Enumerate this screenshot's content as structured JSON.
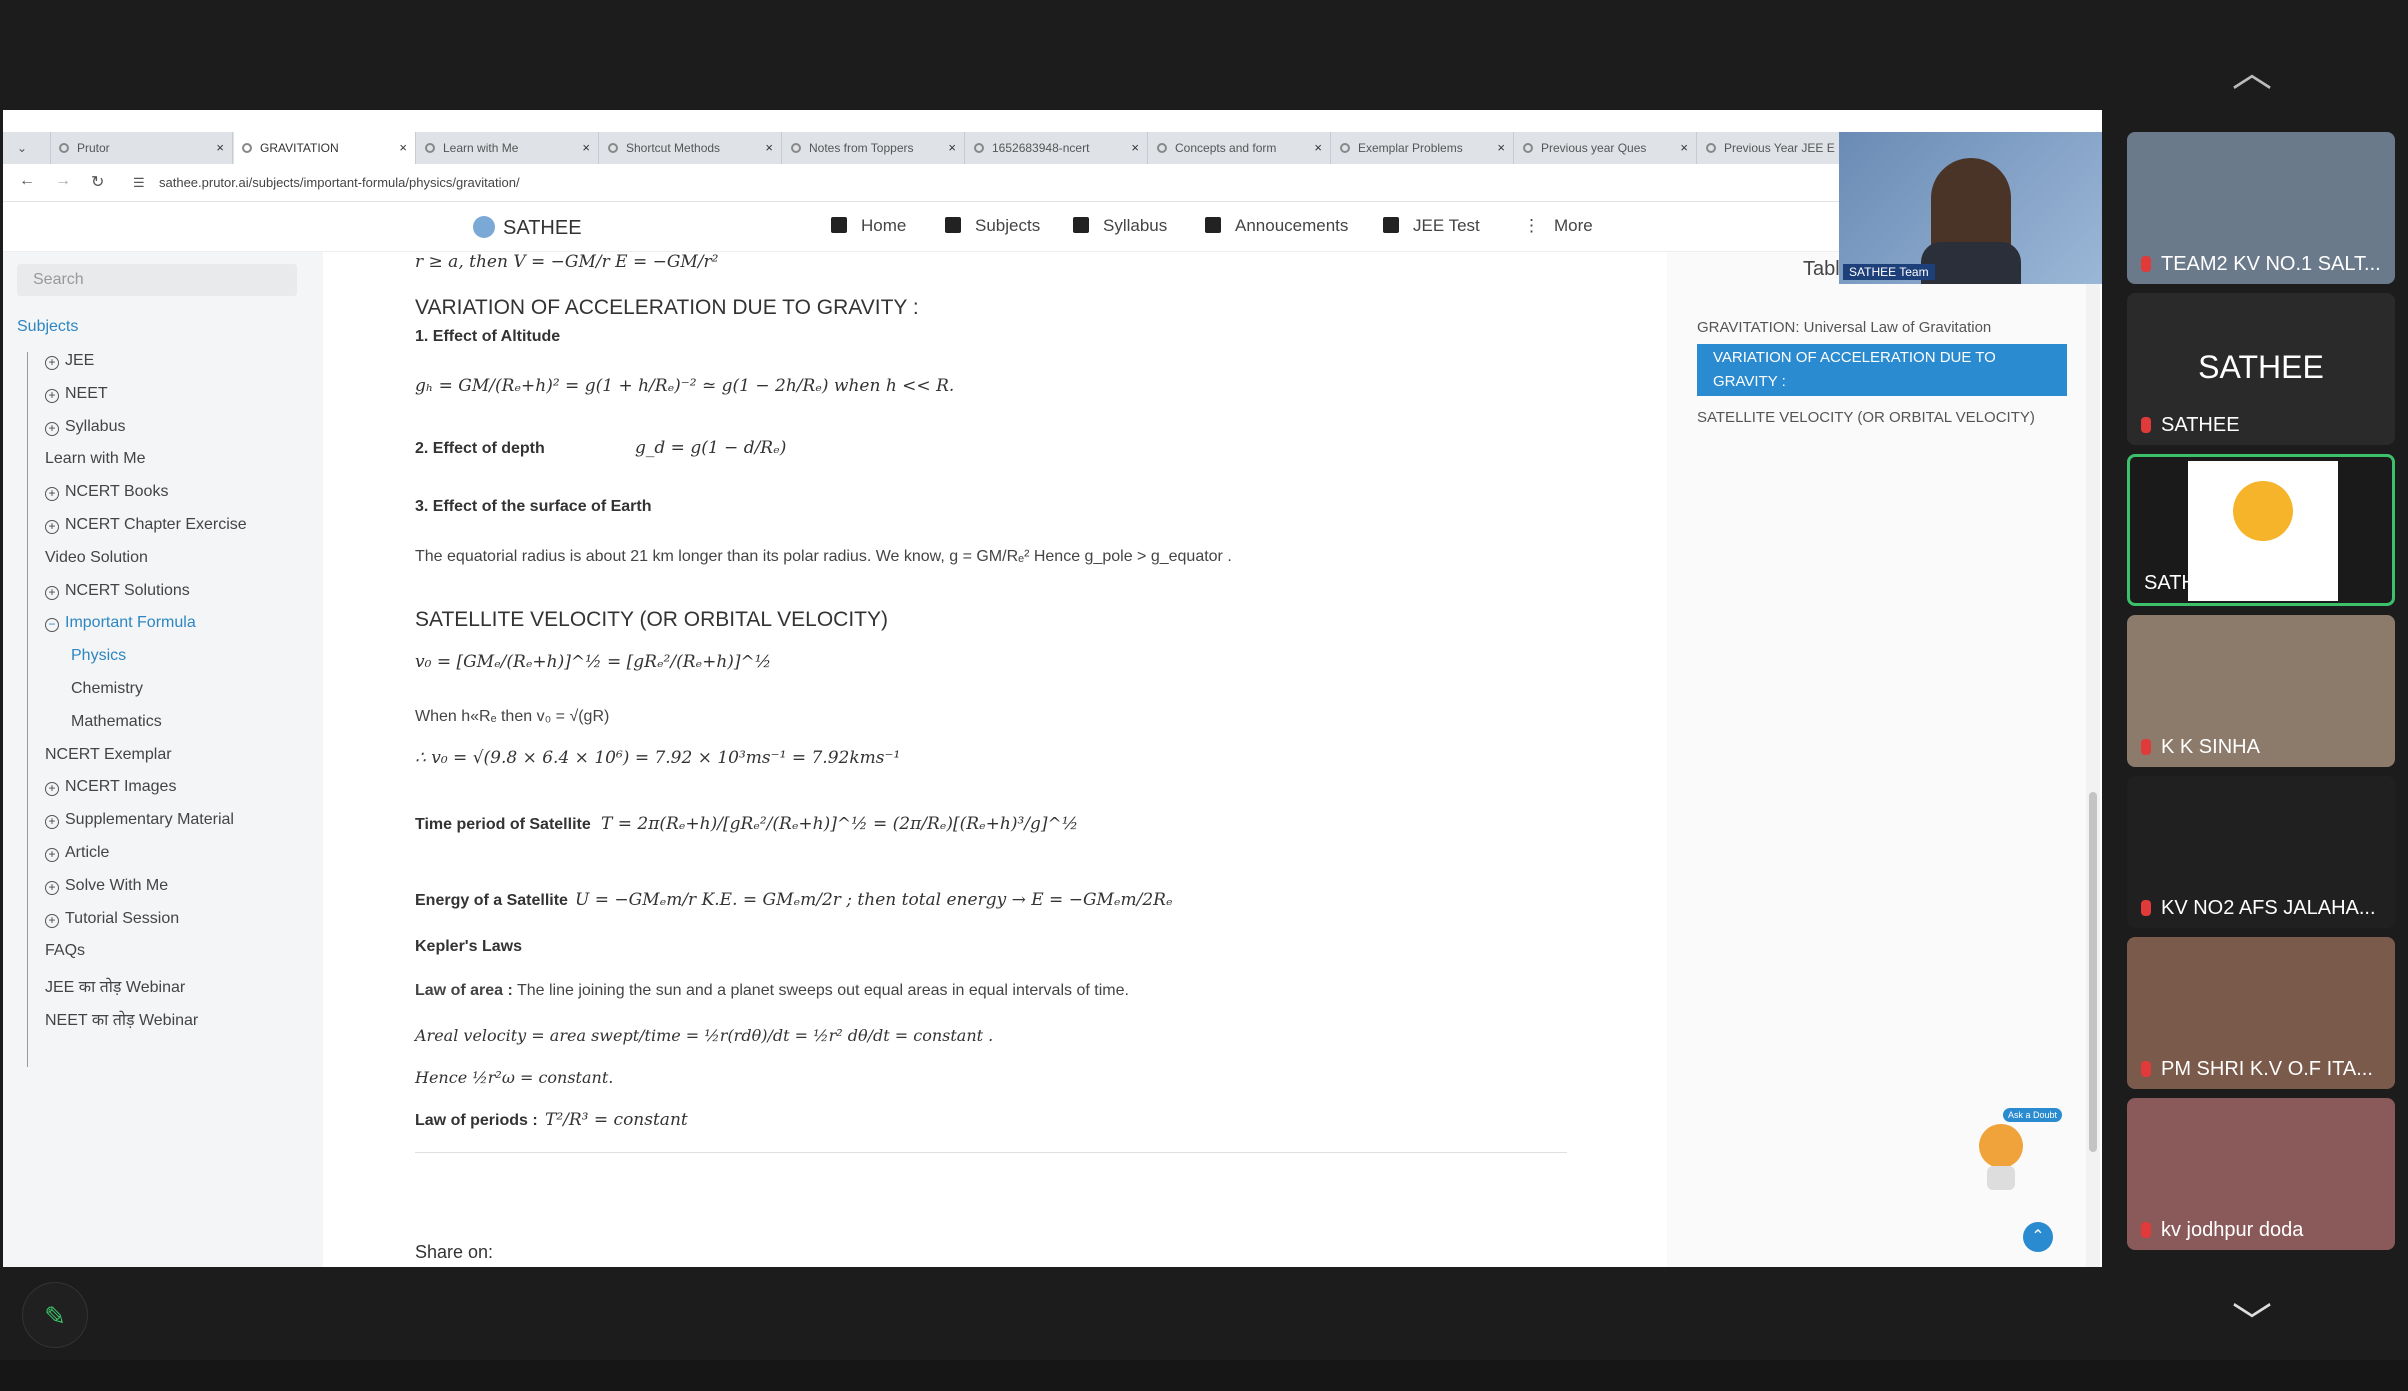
{
  "browser": {
    "tabs": [
      {
        "label": "Prutor"
      },
      {
        "label": "GRAVITATION"
      },
      {
        "label": "Learn with Me"
      },
      {
        "label": "Shortcut Methods"
      },
      {
        "label": "Notes from Toppers"
      },
      {
        "label": "1652683948-ncert"
      },
      {
        "label": "Concepts and form"
      },
      {
        "label": "Exemplar Problems"
      },
      {
        "label": "Previous year Ques"
      },
      {
        "label": "Previous Year JEE E"
      }
    ],
    "url": "sathee.prutor.ai/subjects/important-formula/physics/gravitation/"
  },
  "site": {
    "logo": "SATHEE",
    "nav": [
      {
        "label": "Home"
      },
      {
        "label": "Subjects"
      },
      {
        "label": "Syllabus"
      },
      {
        "label": "Annoucements"
      },
      {
        "label": "JEE Test"
      },
      {
        "label": "More"
      }
    ]
  },
  "sidebar": {
    "search_placeholder": "Search",
    "header": "Subjects",
    "items": [
      {
        "label": "JEE"
      },
      {
        "label": "NEET"
      },
      {
        "label": "Syllabus"
      },
      {
        "label": "Learn with Me"
      },
      {
        "label": "NCERT Books"
      },
      {
        "label": "NCERT Chapter Exercise"
      },
      {
        "label": "Video Solution"
      },
      {
        "label": "NCERT Solutions"
      },
      {
        "label": "Important Formula"
      },
      {
        "label": "Physics"
      },
      {
        "label": "Chemistry"
      },
      {
        "label": "Mathematics"
      },
      {
        "label": "NCERT Exemplar"
      },
      {
        "label": "NCERT Images"
      },
      {
        "label": "Supplementary Material"
      },
      {
        "label": "Article"
      },
      {
        "label": "Solve With Me"
      },
      {
        "label": "Tutorial Session"
      },
      {
        "label": "FAQs"
      },
      {
        "label": "JEE का तोड़ Webinar"
      },
      {
        "label": "NEET का तोड़ Webinar"
      }
    ]
  },
  "content": {
    "top_formula": "r ≥ a, then V = −GM/r    E = −GM/r²",
    "heading1": "VARIATION OF ACCELERATION DUE TO GRAVITY :",
    "alt_title": "1. Effect of Altitude",
    "alt_formula": "gₕ = GM/(Rₑ+h)² = g(1 + h/Rₑ)⁻² ≃ g(1 − 2h/Rₑ)  when h << R.",
    "depth_title": "2. Effect of depth",
    "depth_formula": "g_d = g(1 − d/Rₑ)",
    "surface_title": "3. Effect of the surface of Earth",
    "surface_text": "The equatorial radius is about 21 km longer than its polar radius. We know, g = GM/Rₑ² Hence g_pole > g_equator .",
    "heading2": "SATELLITE VELOCITY (OR ORBITAL VELOCITY)",
    "v0_formula": "v₀ = [GMₑ/(Rₑ+h)]^½ = [gRₑ²/(Rₑ+h)]^½",
    "when_text": "When h«Rₑ then v₀ = √(gR)",
    "v0_calc": "∴    v₀ = √(9.8 × 6.4 × 10⁶) = 7.92 × 10³ms⁻¹ = 7.92kms⁻¹",
    "time_title": "Time period of Satellite",
    "time_formula": "T = 2π(Rₑ+h)/[gRₑ²/(Rₑ+h)]^½ = (2π/Rₑ)[(Rₑ+h)³/g]^½",
    "energy_title": "Energy of a Satellite",
    "energy_formula": "U = −GMₑm/r    K.E. = GMₑm/2r ; then total energy → E = −GMₑm/2Rₑ",
    "kepler_title": "Kepler's Laws",
    "law_area_label": "Law of area :",
    "law_area_text": "The line joining the sun and a planet sweeps out equal areas in equal intervals of time.",
    "areal_text": "Areal velocity = area swept/time = ½r(rdθ)/dt = ½r² dθ/dt = constant .",
    "hence_text": "Hence ½r²ω = constant.",
    "law_periods_label": "Law of periods :",
    "law_periods_formula": "T²/R³ = constant",
    "share_label": "Share on:"
  },
  "toc": {
    "title": "Table of Contents",
    "items": [
      {
        "label": "GRAVITATION: Universal Law of Gravitation"
      },
      {
        "label": "VARIATION OF ACCELERATION DUE TO GRAVITY :"
      },
      {
        "label": "SATELLITE VELOCITY (OR ORBITAL VELOCITY)"
      }
    ]
  },
  "speaker": {
    "label": "SATHEE Team"
  },
  "ask_doubt": "Ask a Doubt",
  "participants": [
    {
      "label": "TEAM2 KV NO.1 SALT..."
    },
    {
      "label": "SATHEE",
      "title": "SATHEE"
    },
    {
      "label": "SATHEE Team"
    },
    {
      "label": "K K SINHA"
    },
    {
      "label": "KV NO2 AFS JALAHA..."
    },
    {
      "label": "PM SHRI K.V O.F ITA..."
    },
    {
      "label": "kv jodhpur doda"
    }
  ],
  "colors": {
    "accent": "#2b8bd0",
    "link": "#2e86c1",
    "tile_active_border": "#3cc06a",
    "mic_off": "#e03a3a"
  }
}
